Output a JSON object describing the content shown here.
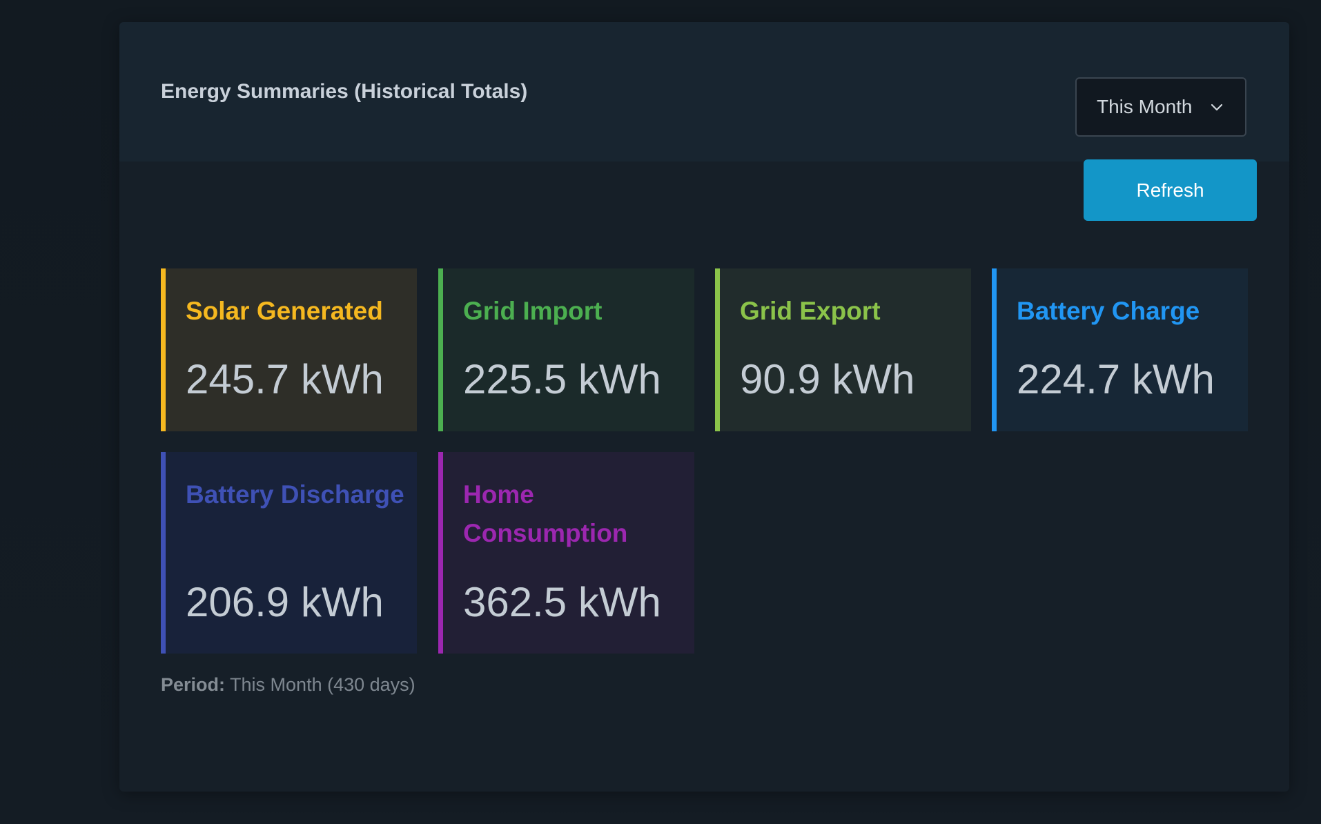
{
  "panel": {
    "title": "Energy Summaries (Historical Totals)"
  },
  "controls": {
    "period_select": {
      "value": "This Month",
      "icon": "chevron-down-icon"
    },
    "refresh_label": "Refresh"
  },
  "cards": [
    {
      "label": "Solar Generated",
      "value": "245.7 kWh",
      "accent": "#f5b820",
      "bg": "#2e2e28"
    },
    {
      "label": "Grid Import",
      "value": "225.5 kWh",
      "accent": "#4caf50",
      "bg": "#1b2a2a"
    },
    {
      "label": "Grid Export",
      "value": "90.9 kWh",
      "accent": "#8bc34a",
      "bg": "#212c2c"
    },
    {
      "label": "Battery Charge",
      "value": "224.7 kWh",
      "accent": "#2196f3",
      "bg": "#172736"
    },
    {
      "label": "Battery Discharge",
      "value": "206.9 kWh",
      "accent": "#3f51b5",
      "bg": "#18223a"
    },
    {
      "label": "Home Consumption",
      "value": "362.5 kWh",
      "accent": "#9c27b0",
      "bg": "#221f35"
    }
  ],
  "footer": {
    "label": "Period:",
    "text": "This Month (430 days)"
  },
  "colors": {
    "page_bg": "#111920",
    "panel_bg": "#161f28",
    "header_bg": "#182530",
    "button": "#1396c8"
  }
}
